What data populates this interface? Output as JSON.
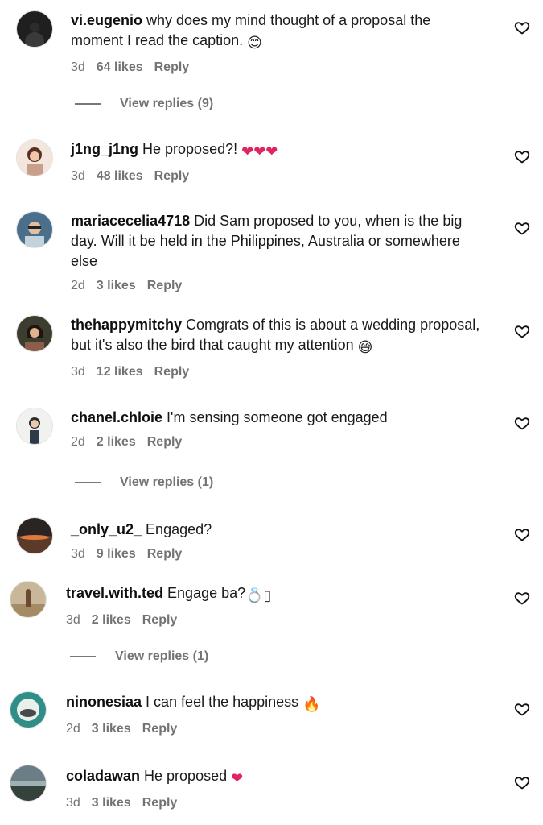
{
  "comments": [
    {
      "user": "vi.eugenio",
      "text": "why does my mind thought of a proposal the moment I read the caption.",
      "emoji": "😊",
      "time": "3d",
      "likes": "64 likes",
      "reply": "Reply"
    },
    {
      "user": "j1ng_j1ng",
      "text": "He proposed?!",
      "emoji": "❤❤❤",
      "time": "3d",
      "likes": "48 likes",
      "reply": "Reply"
    },
    {
      "user": "mariacecelia4718",
      "text": "Did Sam proposed to you, when is the big day. Will it be held in the Philippines, Australia or somewhere else",
      "emoji": "",
      "time": "2d",
      "likes": "3 likes",
      "reply": "Reply"
    },
    {
      "user": "thehappymitchy",
      "text": "Comgrats of this is about a wedding proposal, but it's also the bird that caught my attention",
      "emoji": "😅",
      "time": "3d",
      "likes": "12 likes",
      "reply": "Reply"
    },
    {
      "user": "chanel.chloie",
      "text": "I'm sensing someone got engaged",
      "emoji": "",
      "time": "2d",
      "likes": "2 likes",
      "reply": "Reply"
    },
    {
      "user": "_only_u2_",
      "text": "Engaged?",
      "emoji": "",
      "time": "3d",
      "likes": "9 likes",
      "reply": "Reply"
    },
    {
      "user": "travel.with.ted",
      "text": "Engage ba?",
      "emoji": "💍▯",
      "time": "3d",
      "likes": "2 likes",
      "reply": "Reply"
    },
    {
      "user": "ninonesiaa",
      "text": "I can feel the happiness",
      "emoji": "🔥",
      "time": "2d",
      "likes": "3 likes",
      "reply": "Reply"
    },
    {
      "user": "coladawan",
      "text": "He proposed",
      "emoji": "❤",
      "time": "3d",
      "likes": "3 likes",
      "reply": "Reply"
    }
  ],
  "view_replies": [
    {
      "label": "View replies (9)"
    },
    {
      "label": "View replies (1)"
    },
    {
      "label": "View replies (1)"
    }
  ],
  "icons": {
    "like": "heart-outline-icon",
    "avatar": "profile-avatar-icon"
  },
  "colors": {
    "meta": "#737373",
    "text": "#1a1a1a",
    "heart_emoji": "#e0245e"
  }
}
